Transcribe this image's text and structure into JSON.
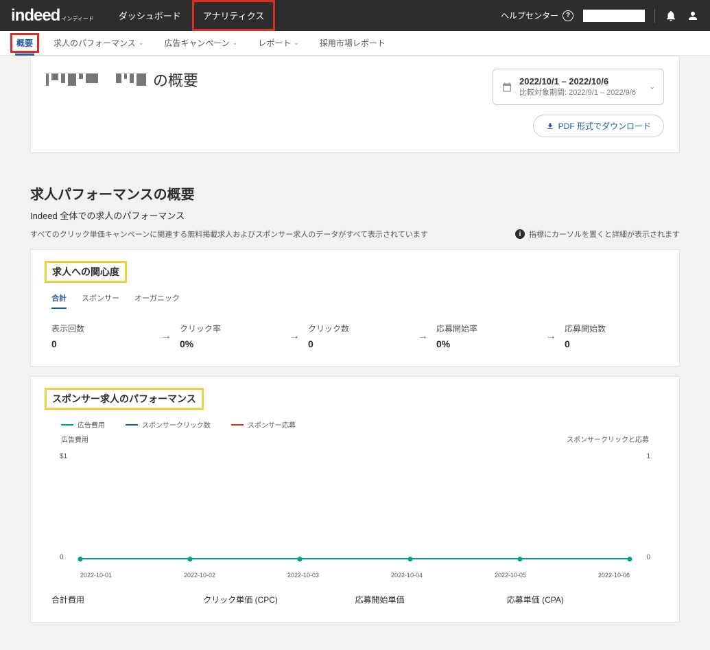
{
  "topbar": {
    "logo": "indeed",
    "logo_sub": "インディード",
    "nav": {
      "dashboard": "ダッシュボード",
      "analytics": "アナリティクス"
    },
    "help": "ヘルプセンター"
  },
  "subnav": {
    "overview": "概要",
    "job_perf": "求人のパフォーマンス",
    "campaign": "広告キャンペーン",
    "report": "レポート",
    "market": "採用市場レポート"
  },
  "header": {
    "title_suffix": "の概要",
    "date_main": "2022/10/1 – 2022/10/6",
    "date_sub": "比較対象期間: 2022/9/1 – 2022/9/6",
    "pdf_btn": "PDF 形式でダウンロード"
  },
  "perf_section": {
    "title": "求人パフォーマンスの概要",
    "sub1": "Indeed 全体での求人のパフォーマンス",
    "sub2": "すべてのクリック単価キャンペーンに関連する無料掲載求人およびスポンサー求人のデータがすべて表示されています",
    "hint": "指標にカーソルを置くと詳細が表示されます"
  },
  "interest": {
    "box_title": "求人への関心度",
    "tabs": {
      "total": "合計",
      "sponsor": "スポンサー",
      "organic": "オーガニック"
    },
    "metrics": [
      {
        "label": "表示回数",
        "value": "0"
      },
      {
        "label": "クリック率",
        "value": "0%"
      },
      {
        "label": "クリック数",
        "value": "0"
      },
      {
        "label": "応募開始率",
        "value": "0%"
      },
      {
        "label": "応募開始数",
        "value": "0"
      }
    ]
  },
  "sponsor": {
    "box_title": "スポンサー求人のパフォーマンス",
    "legend": {
      "cost": "広告費用",
      "clicks": "スポンサークリック数",
      "apply": "スポンサー応募"
    },
    "legend_colors": {
      "cost": "#00a38d",
      "clicks": "#2557a7",
      "apply": "#d93025"
    },
    "y_left_label": "広告費用",
    "y_right_label": "スポンサークリックと応募",
    "bottom": {
      "total": "合計費用",
      "cpc": "クリック単価 (CPC)",
      "cpas": "応募開始単価",
      "cpa": "応募単価 (CPA)"
    }
  },
  "chart_data": {
    "type": "line",
    "x": [
      "2022-10-01",
      "2022-10-02",
      "2022-10-03",
      "2022-10-04",
      "2022-10-05",
      "2022-10-06"
    ],
    "series": [
      {
        "name": "広告費用",
        "values": [
          0,
          0,
          0,
          0,
          0,
          0
        ],
        "axis": "left",
        "color": "#00a38d"
      },
      {
        "name": "スポンサークリック数",
        "values": [
          0,
          0,
          0,
          0,
          0,
          0
        ],
        "axis": "right",
        "color": "#2557a7"
      },
      {
        "name": "スポンサー応募",
        "values": [
          0,
          0,
          0,
          0,
          0,
          0
        ],
        "axis": "right",
        "color": "#d93025"
      }
    ],
    "y_left": {
      "label": "広告費用",
      "ticks": [
        "$1",
        "0"
      ],
      "range": [
        0,
        1
      ]
    },
    "y_right": {
      "label": "スポンサークリックと応募",
      "ticks": [
        "1",
        "0"
      ],
      "range": [
        0,
        1
      ]
    }
  }
}
